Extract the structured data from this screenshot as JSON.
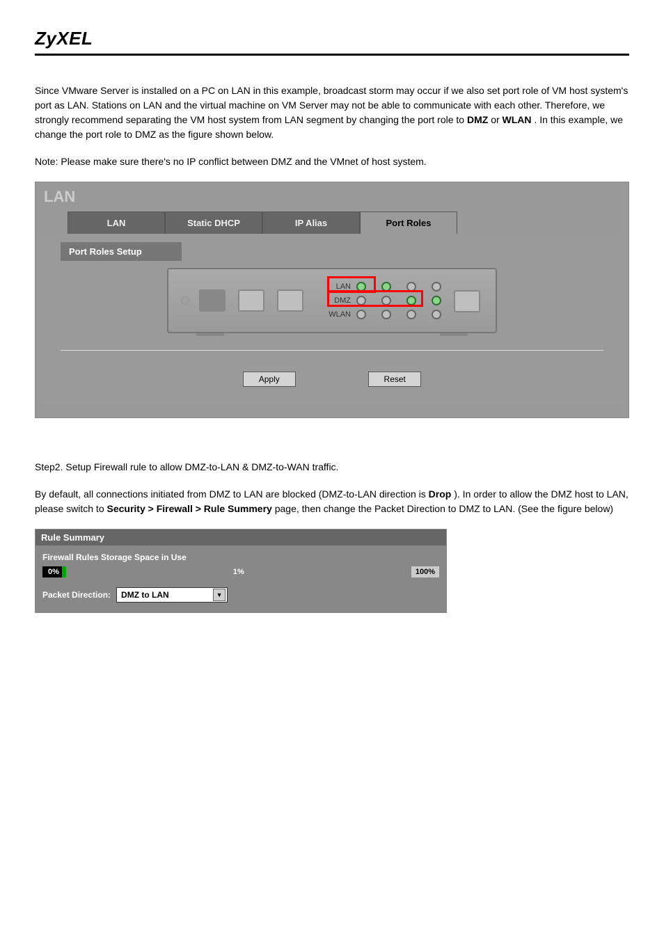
{
  "brand": "ZyXEL",
  "intro_p1": "Since VMware Server is installed on a PC on LAN in this example, broadcast storm may occur if we also set port role of VM host system's port as LAN. Stations on LAN and the virtual machine on VM Server may not be able to communicate with each other. Therefore, we strongly recommend separating the VM host system from LAN segment by changing the port role to ",
  "intro_dmz": "DMZ",
  "intro_or": " or ",
  "intro_wlan": "WLAN",
  "intro_end": ". In this example, we change the port role to DMZ as the figure shown below.",
  "note": "Note: Please make sure there's no IP conflict between DMZ and the VMnet of host system.",
  "shot1": {
    "title": "LAN",
    "tabs": [
      "LAN",
      "Static DHCP",
      "IP Alias",
      "Port Roles"
    ],
    "activeTab": 3,
    "panelLabel": "Port Roles Setup",
    "rowLabels": [
      "LAN",
      "DMZ",
      "WLAN"
    ],
    "apply": "Apply",
    "reset": "Reset"
  },
  "mid_p": "Step2. Setup Firewall rule to allow DMZ-to-LAN & DMZ-to-WAN traffic.",
  "mid_p2a": "By default, all connections initiated from DMZ to LAN are blocked (DMZ-to-LAN direction is ",
  "mid_p2_drop": "Drop",
  "mid_p2b": "). In order to allow the DMZ host to LAN, please switch to ",
  "mid_p2c": " page, then change the Packet Direction to DMZ to LAN. (See the figure below)",
  "mid_bold": "Security > Firewall > Rule Summery",
  "shot2": {
    "head": "Rule Summary",
    "storage": "Firewall Rules Storage Space in Use",
    "p0": "0%",
    "pmid": "1%",
    "p100": "100%",
    "pkdirLabel": "Packet Direction:",
    "pkdirValue": "DMZ to LAN"
  }
}
